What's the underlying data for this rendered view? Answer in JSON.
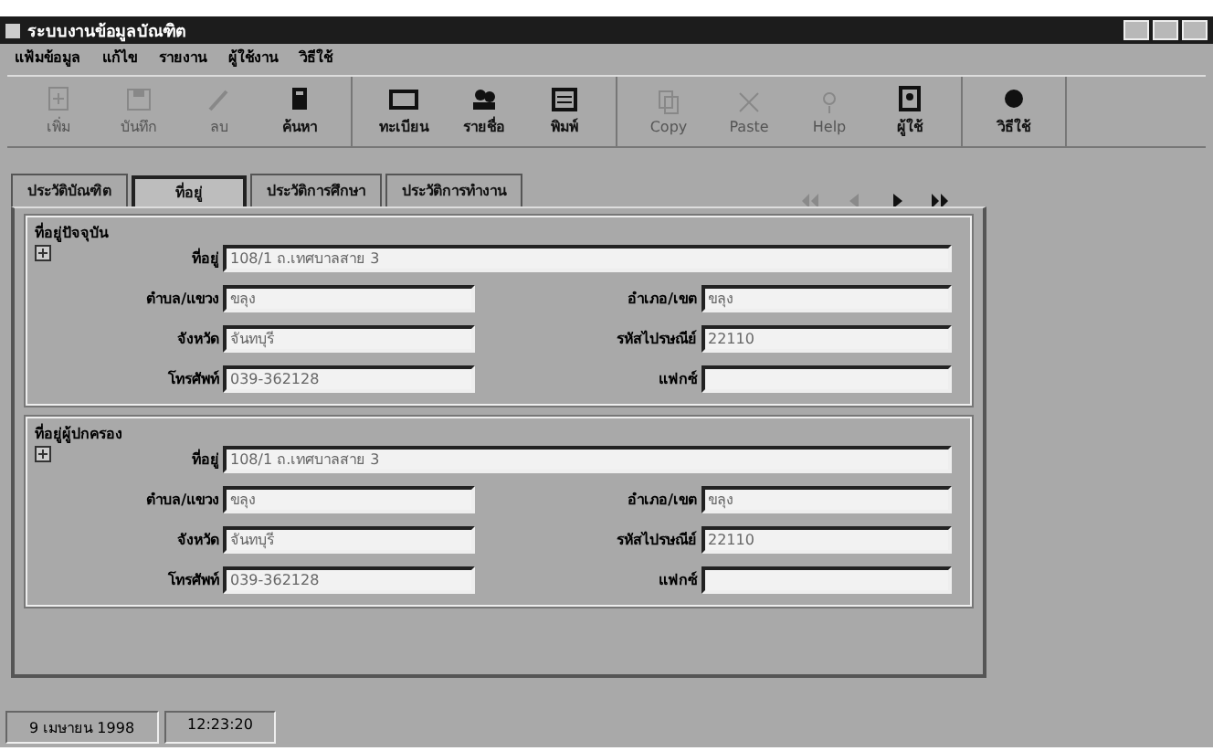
{
  "window": {
    "title": "ระบบงานข้อมูลบัณฑิต"
  },
  "menu": [
    "แฟ้มข้อมูล",
    "แก้ไข",
    "รายงาน",
    "ผู้ใช้งาน",
    "วิธีใช้"
  ],
  "toolbar": [
    {
      "label": "เพิ่ม",
      "disabled": true
    },
    {
      "label": "บันทึก",
      "disabled": true
    },
    {
      "label": "ลบ",
      "disabled": true
    },
    {
      "label": "ค้นหา",
      "disabled": false
    },
    {
      "label": "ทะเบียน",
      "disabled": false
    },
    {
      "label": "รายชื่อ",
      "disabled": false
    },
    {
      "label": "พิมพ์",
      "disabled": false
    },
    {
      "label": "Copy",
      "disabled": true
    },
    {
      "label": "Paste",
      "disabled": true
    },
    {
      "label": "Help",
      "disabled": true
    },
    {
      "label": "ผู้ใช้",
      "disabled": false
    },
    {
      "label": "วิธีใช้",
      "disabled": false
    }
  ],
  "tabs": [
    {
      "label": "ประวัติบัณฑิต",
      "selected": false
    },
    {
      "label": "ที่อยู่",
      "selected": true
    },
    {
      "label": "ประวัติการศึกษา",
      "selected": false
    },
    {
      "label": "ประวัติการทำงาน",
      "selected": false
    }
  ],
  "navigation": [
    {
      "kind": "first",
      "disabled": true
    },
    {
      "kind": "prev",
      "disabled": true
    },
    {
      "kind": "next",
      "disabled": false
    },
    {
      "kind": "last",
      "disabled": false
    }
  ],
  "groups": [
    {
      "title": "ที่อยู่ปัจจุบัน",
      "fields": [
        {
          "label": "ที่อยู่",
          "value": "108/1 ถ.เทศบาลสาย 3",
          "kind": "wide"
        },
        {
          "label": "ตำบล/แขวง",
          "value": "ขลุง",
          "kind": "half"
        },
        {
          "label": "อำเภอ/เขต",
          "value": "ขลุง",
          "kind": "half"
        },
        {
          "label": "จังหวัด",
          "value": "จันทบุรี",
          "kind": "half"
        },
        {
          "label": "รหัสไปรษณีย์",
          "value": "22110",
          "kind": "half"
        },
        {
          "label": "โทรศัพท์",
          "value": "039-362128",
          "kind": "half"
        },
        {
          "label": "แฟกซ์",
          "kind": "half"
        }
      ]
    },
    {
      "title": "ที่อยู่ผู้ปกครอง",
      "fields": [
        {
          "label": "ที่อยู่",
          "value": "108/1 ถ.เทศบาลสาย 3",
          "kind": "wide"
        },
        {
          "label": "ตำบล/แขวง",
          "value": "ขลุง",
          "kind": "half"
        },
        {
          "label": "อำเภอ/เขต",
          "value": "ขลุง",
          "kind": "half"
        },
        {
          "label": "จังหวัด",
          "value": "จันทบุรี",
          "kind": "half"
        },
        {
          "label": "รหัสไปรษณีย์",
          "value": "22110",
          "kind": "half"
        },
        {
          "label": "โทรศัพท์",
          "value": "039-362128",
          "kind": "half"
        },
        {
          "label": "แฟกซ์",
          "kind": "half"
        }
      ]
    }
  ],
  "status_bar": [
    "9 เมษายน 1998",
    "12:23:20"
  ]
}
